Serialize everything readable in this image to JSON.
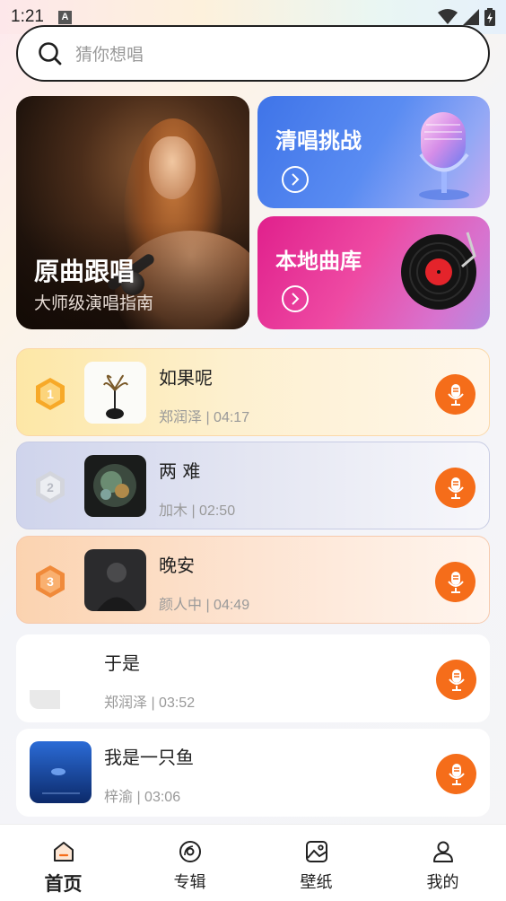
{
  "status_bar": {
    "time": "1:21",
    "notification_letter": "A"
  },
  "search": {
    "placeholder": "猜你想唱"
  },
  "banners": {
    "main": {
      "title": "原曲跟唱",
      "subtitle": "大师级演唱指南"
    },
    "challenge": {
      "title": "清唱挑战"
    },
    "library": {
      "title": "本地曲库"
    }
  },
  "songs": [
    {
      "rank": "1",
      "title": "如果呢",
      "meta": "郑润泽 | 04:17",
      "rank_color": "#f7a928"
    },
    {
      "rank": "2",
      "title": "两 难",
      "meta": "加木 | 02:50",
      "rank_color": "#c9cbd2"
    },
    {
      "rank": "3",
      "title": "晚安",
      "meta": "颜人中 | 04:49",
      "rank_color": "#f08a3a"
    },
    {
      "rank": "",
      "title": "于是",
      "meta": "郑润泽 | 03:52"
    },
    {
      "rank": "",
      "title": "我是一只鱼",
      "meta": "梓渝 | 03:06"
    }
  ],
  "bottom_nav": [
    {
      "label": "首页",
      "icon": "home-icon",
      "active": true
    },
    {
      "label": "专辑",
      "icon": "disc-icon",
      "active": false
    },
    {
      "label": "壁纸",
      "icon": "image-icon",
      "active": false
    },
    {
      "label": "我的",
      "icon": "user-icon",
      "active": false
    }
  ],
  "colors": {
    "accent": "#f56d1a",
    "text": "#222222",
    "meta": "#999999"
  }
}
